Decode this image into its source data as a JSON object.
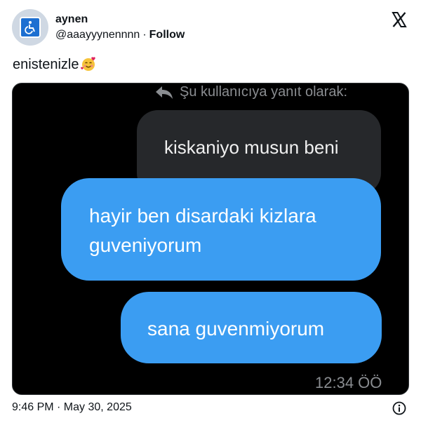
{
  "author": {
    "display_name": "aynen",
    "handle": "@aaayyynennnn",
    "separator": "·",
    "follow_label": "Follow",
    "avatar_icon": "wheelchair-sign-icon"
  },
  "brand": {
    "icon": "x-logo-icon"
  },
  "tweet": {
    "text": "enistenizle",
    "emoji_icon": "smiling-face-with-hearts-icon",
    "timestamp": "9:46 PM · May 30, 2025"
  },
  "media": {
    "reply_label": "Şu kullanıcıya yanıt olarak:",
    "quoted_message": "kiskaniyo musun beni",
    "messages": [
      {
        "lines": [
          "hayir ben disardaki kizlara",
          "guveniyorum"
        ]
      },
      {
        "lines": [
          "sana guvenmiyorum"
        ]
      }
    ],
    "time": "12:34 ÖÖ",
    "colors": {
      "background": "#000000",
      "sent_bubble": "#3b9df2",
      "received_bubble": "#26282b"
    }
  },
  "footer": {
    "info_icon": "info-icon"
  }
}
